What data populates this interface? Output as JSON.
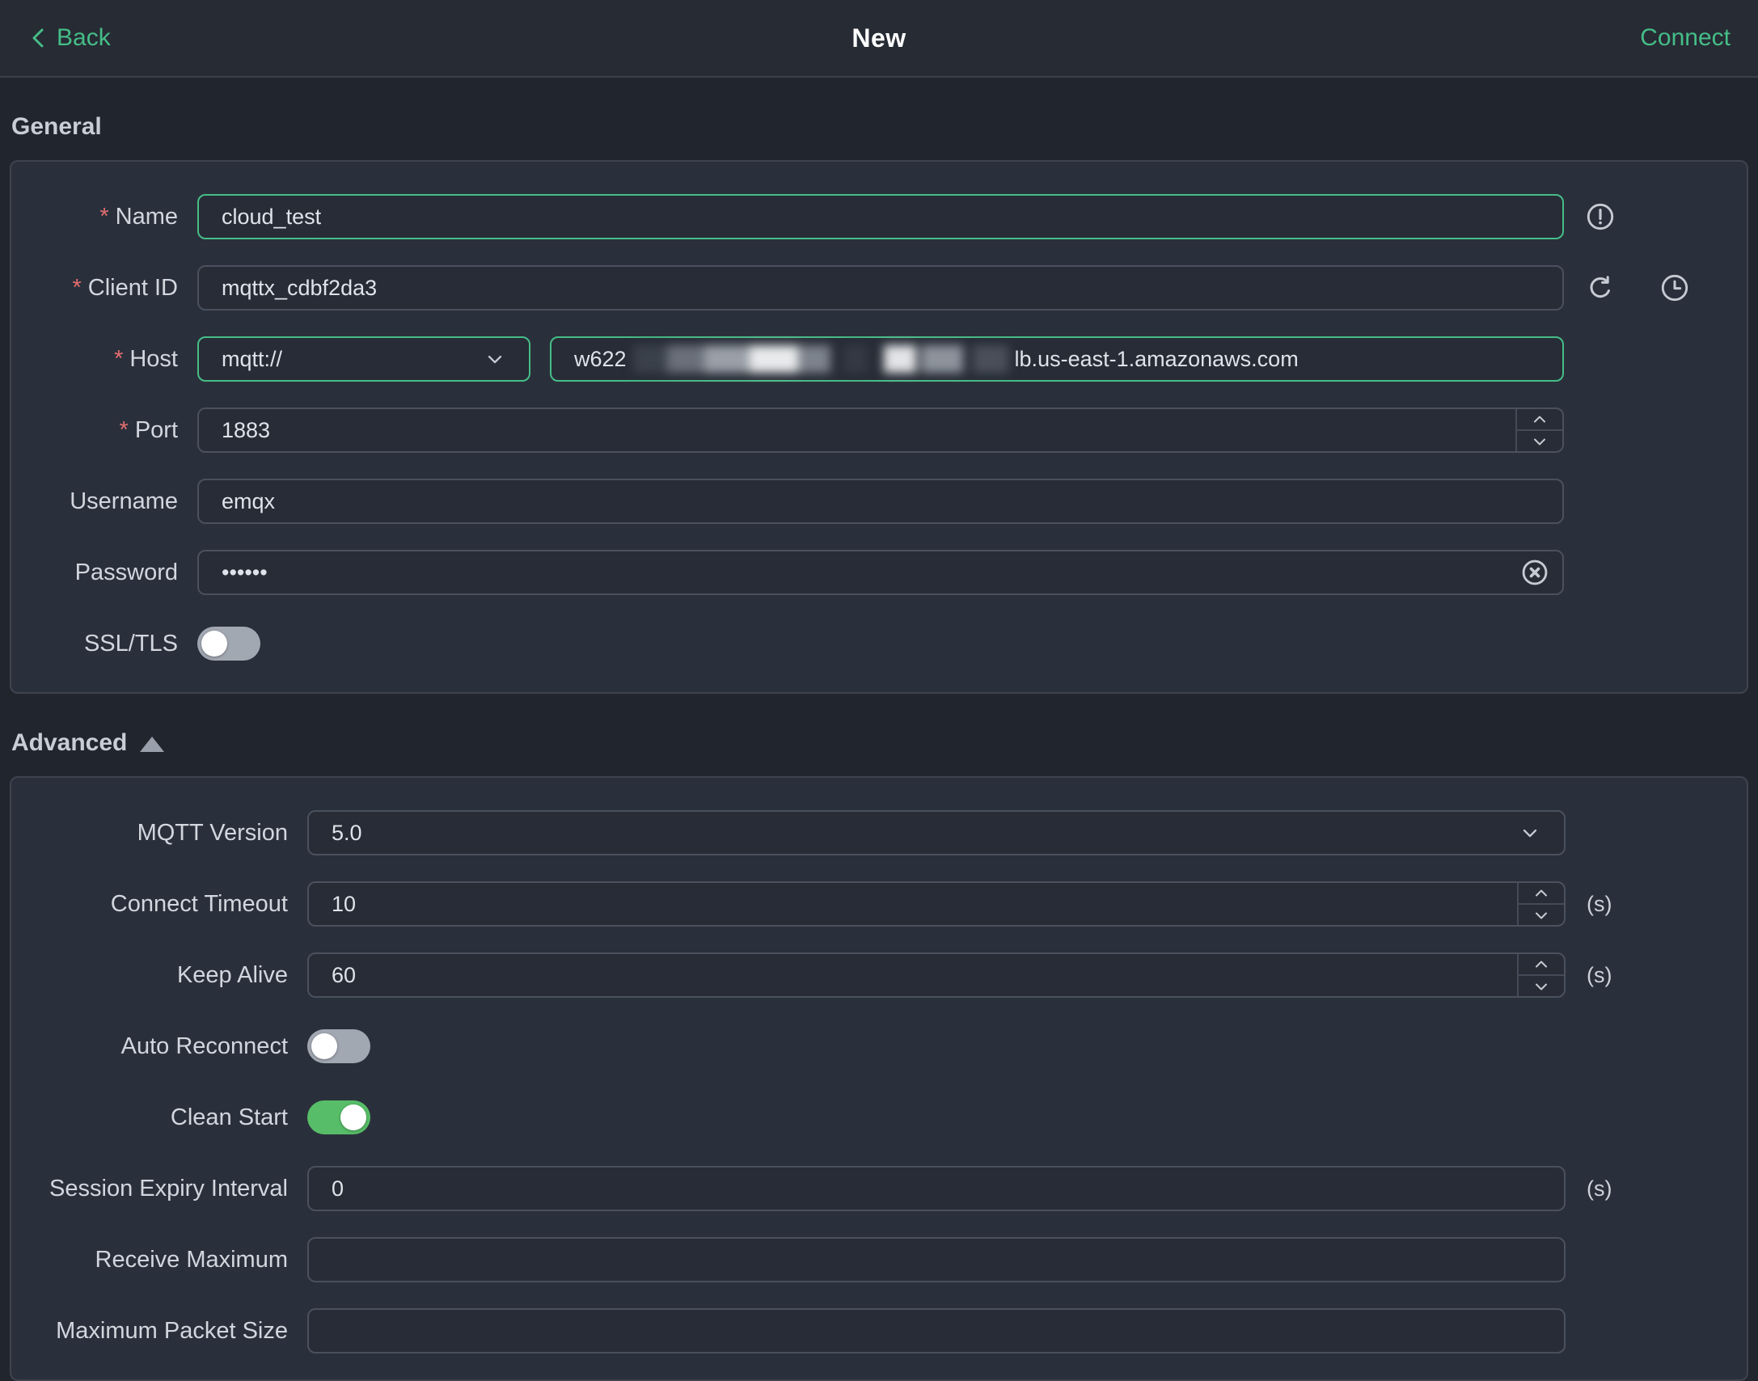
{
  "colors": {
    "accent_green": "#46bd87",
    "toggle_on_green": "#57bd68",
    "required_red": "#e36d6f"
  },
  "topbar": {
    "back_icon": "chevron-left",
    "back_label": "Back",
    "title": "New",
    "connect_label": "Connect"
  },
  "ui": {
    "required_marker": "*",
    "collapse_icon": "triangle-up"
  },
  "general": {
    "title": "General",
    "name": {
      "label": "Name",
      "value": "cloud_test",
      "status_icon": "exclamation-circle"
    },
    "client_id": {
      "label": "Client ID",
      "value": "mqttx_cdbf2da3",
      "refresh_icon": "refresh",
      "history_icon": "clock"
    },
    "host": {
      "label": "Host",
      "protocol": "mqtt://",
      "value_prefix": "w622",
      "value_suffix": "lb.us-east-1.amazonaws.com",
      "redacted": true
    },
    "port": {
      "label": "Port",
      "value": "1883"
    },
    "username": {
      "label": "Username",
      "value": "emqx"
    },
    "password": {
      "label": "Password",
      "value": "••••••",
      "clear_icon": "circle-x"
    },
    "ssl": {
      "label": "SSL/TLS",
      "enabled": false
    }
  },
  "advanced": {
    "title": "Advanced",
    "mqtt_version": {
      "label": "MQTT Version",
      "value": "5.0"
    },
    "connect_timeout": {
      "label": "Connect Timeout",
      "value": "10",
      "unit": "(s)"
    },
    "keep_alive": {
      "label": "Keep Alive",
      "value": "60",
      "unit": "(s)"
    },
    "auto_reconnect": {
      "label": "Auto Reconnect",
      "enabled": false
    },
    "clean_start": {
      "label": "Clean Start",
      "enabled": true
    },
    "session_expiry_interval": {
      "label": "Session Expiry Interval",
      "value": "0",
      "unit": "(s)"
    },
    "receive_maximum": {
      "label": "Receive Maximum",
      "value": ""
    },
    "maximum_packet_size": {
      "label": "Maximum Packet Size",
      "value": ""
    }
  }
}
